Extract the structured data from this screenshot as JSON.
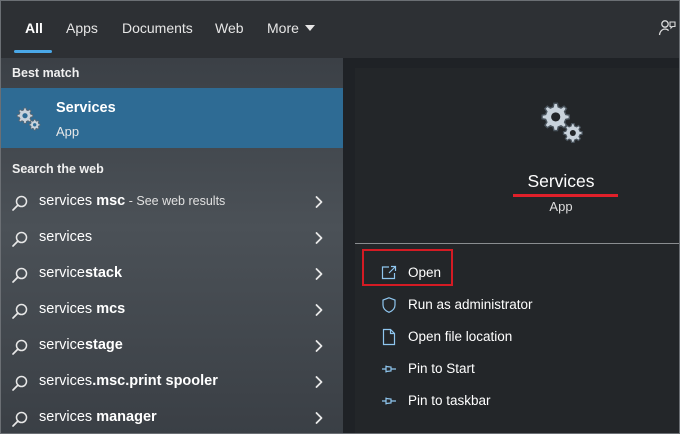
{
  "tabs": [
    {
      "label": "All",
      "active": true
    },
    {
      "label": "Apps",
      "active": false
    },
    {
      "label": "Documents",
      "active": false
    },
    {
      "label": "Web",
      "active": false
    },
    {
      "label": "More",
      "active": false
    }
  ],
  "left": {
    "best_match_label": "Best match",
    "best_match": {
      "title": "Services",
      "subtitle": "App",
      "icon": "services-gears-icon"
    },
    "search_web_label": "Search the web",
    "web_results": [
      {
        "prefix": "services",
        "bold": " msc",
        "suffix": "",
        "see": " - See web results"
      },
      {
        "prefix": "services",
        "bold": "",
        "suffix": "",
        "see": ""
      },
      {
        "prefix": "service",
        "bold": "stack",
        "suffix": "",
        "see": ""
      },
      {
        "prefix": "services",
        "bold": " mcs",
        "suffix": "",
        "see": ""
      },
      {
        "prefix": "service",
        "bold": "stage",
        "suffix": "",
        "see": ""
      },
      {
        "prefix": "services",
        "bold": ".msc.print spooler",
        "suffix": "",
        "see": ""
      },
      {
        "prefix": "services",
        "bold": " manager",
        "suffix": "",
        "see": ""
      }
    ]
  },
  "right": {
    "app_name": "Services",
    "app_type": "App",
    "actions": [
      {
        "label": "Open",
        "icon": "open-window-icon"
      },
      {
        "label": "Run as administrator",
        "icon": "shield-icon"
      },
      {
        "label": "Open file location",
        "icon": "file-location-icon"
      },
      {
        "label": "Pin to Start",
        "icon": "pin-icon"
      },
      {
        "label": "Pin to taskbar",
        "icon": "pin-icon"
      }
    ]
  },
  "colors": {
    "accent": "#4aa8e8",
    "selection": "#2e6b94",
    "highlight_red": "#d41b24"
  }
}
